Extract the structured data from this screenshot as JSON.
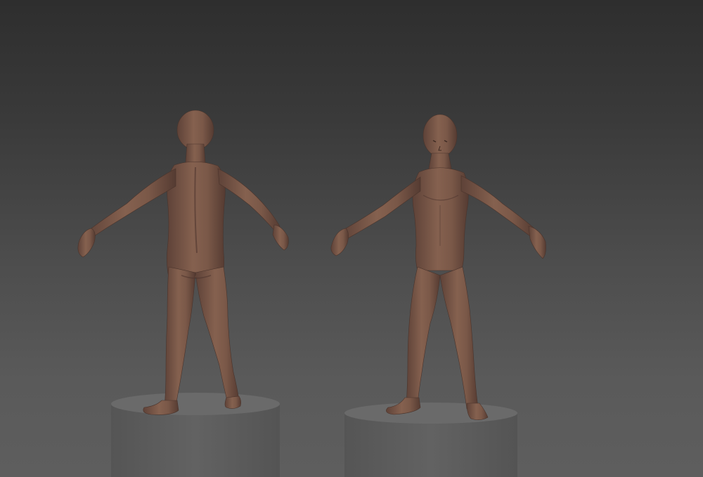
{
  "scene": {
    "background_top": "#2e2e2e",
    "background_bottom": "#5e5e5e",
    "skin_color": "#7a5a4e",
    "skin_shadow": "#5a3f36",
    "skin_highlight": "#9a7566",
    "pedestal_color": "#5c5c5c",
    "pedestal_top": "#666666"
  },
  "figures": [
    {
      "name": "back-view-figure",
      "view": "back"
    },
    {
      "name": "front-view-figure",
      "view": "front"
    }
  ]
}
